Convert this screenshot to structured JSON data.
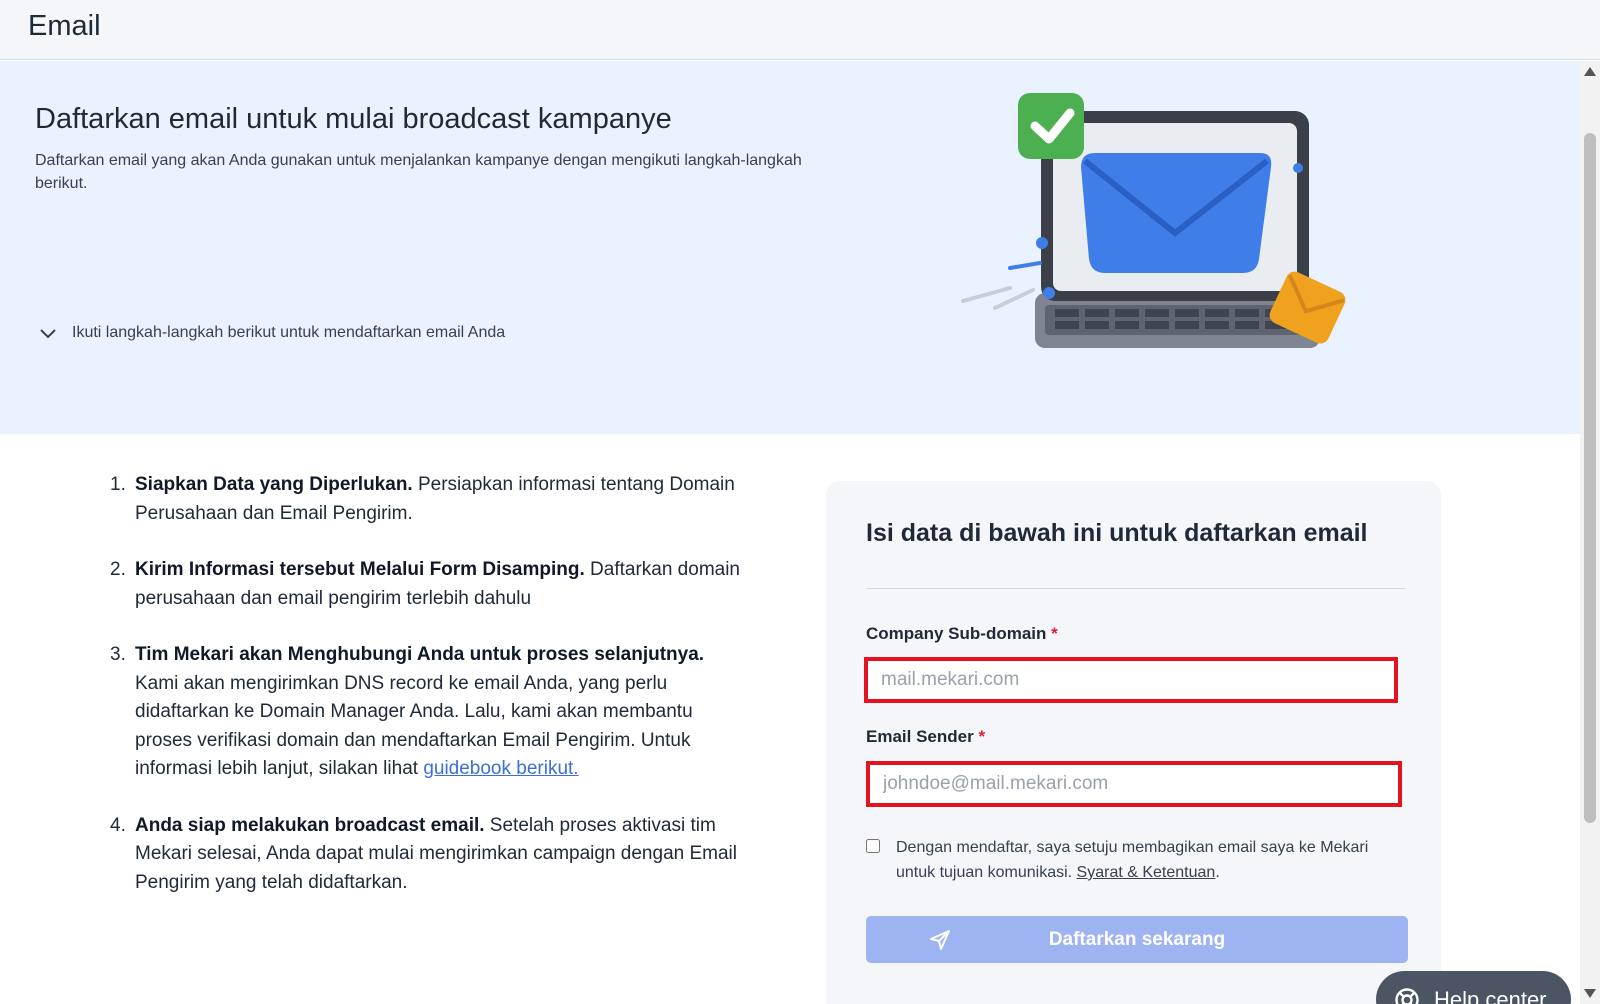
{
  "header": {
    "title": "Email"
  },
  "hero": {
    "title": "Daftarkan email untuk mulai broadcast kampanye",
    "description": "Daftarkan email yang akan Anda gunakan untuk menjalankan kampanye dengan mengikuti langkah-langkah berikut.",
    "toggle_label": "Ikuti langkah-langkah berikut untuk mendaftarkan email Anda",
    "toggle_icon": "chevron-down-icon",
    "illustration": "laptop-envelope-illustration"
  },
  "steps": [
    {
      "number": "1.",
      "title": "Siapkan Data yang Diperlukan.",
      "text": " Persiapkan informasi tentang Domain Perusahaan dan Email Pengirim."
    },
    {
      "number": "2.",
      "title": "Kirim Informasi tersebut Melalui Form Disamping.",
      "text": " Daftarkan domain perusahaan dan email pengirim terlebih dahulu"
    },
    {
      "number": "3.",
      "title": "Tim Mekari akan Menghubungi Anda untuk proses selanjutnya.",
      "text": " Kami akan mengirimkan DNS record ke email Anda, yang perlu didaftarkan ke Domain Manager Anda. Lalu, kami akan membantu proses verifikasi domain dan mendaftarkan Email Pengirim. Untuk informasi lebih lanjut, silakan lihat ",
      "link": "guidebook berikut."
    },
    {
      "number": "4.",
      "title": "Anda siap melakukan broadcast email.",
      "text": " Setelah proses aktivasi tim Mekari selesai, Anda dapat mulai mengirimkan campaign dengan Email Pengirim yang telah didaftarkan."
    }
  ],
  "form": {
    "title": "Isi data di bawah ini untuk daftarkan email",
    "subdomain_label": "Company Sub-domain",
    "subdomain_placeholder": "mail.mekari.com",
    "subdomain_value": "",
    "sender_label": "Email Sender",
    "sender_placeholder": "johndoe@mail.mekari.com",
    "sender_value": "",
    "required_marker": "*",
    "consent_text": "Dengan mendaftar, saya setuju membagikan email saya ke Mekari untuk tujuan komunikasi. ",
    "consent_link": "Syarat & Ketentuan",
    "consent_end": ".",
    "consent_checked": false,
    "submit_label": "Daftarkan sekarang",
    "submit_icon": "send-icon"
  },
  "help": {
    "label": "Help center",
    "icon": "lifebuoy-icon"
  },
  "colors": {
    "hero_bg": "#eaf1ff",
    "card_bg": "#f4f6f9",
    "submit_bg": "#9eb3f1",
    "highlight": "#e3141f",
    "link": "#3b6fd8",
    "help_bg": "#4b5563"
  }
}
